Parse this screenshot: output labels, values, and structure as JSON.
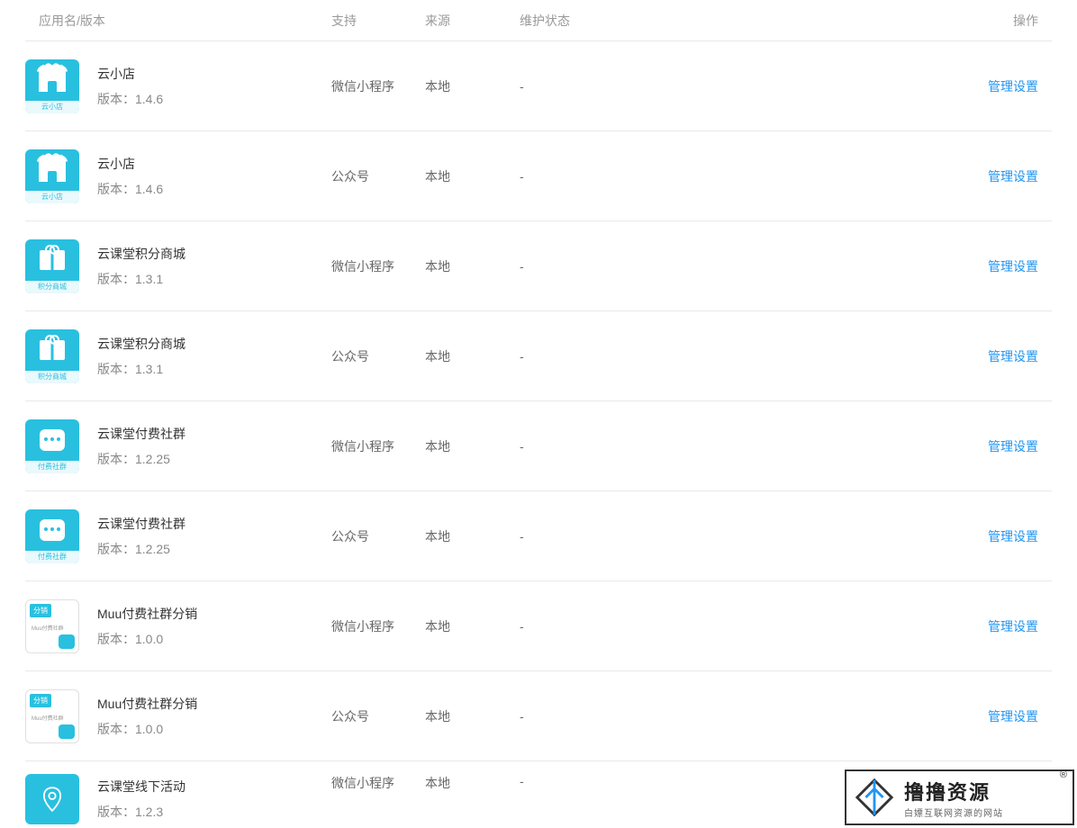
{
  "header": {
    "name": "应用名/版本",
    "support": "支持",
    "source": "来源",
    "status": "维护状态",
    "action": "操作"
  },
  "version_prefix": "版本：",
  "action_label": "管理设置",
  "rows": [
    {
      "name": "云小店",
      "version": "1.4.6",
      "support": "微信小程序",
      "source": "本地",
      "status": "-",
      "icon": "shop",
      "icon_label": "云小店"
    },
    {
      "name": "云小店",
      "version": "1.4.6",
      "support": "公众号",
      "source": "本地",
      "status": "-",
      "icon": "shop",
      "icon_label": "云小店"
    },
    {
      "name": "云课堂积分商城",
      "version": "1.3.1",
      "support": "微信小程序",
      "source": "本地",
      "status": "-",
      "icon": "gift",
      "icon_label": "积分商城"
    },
    {
      "name": "云课堂积分商城",
      "version": "1.3.1",
      "support": "公众号",
      "source": "本地",
      "status": "-",
      "icon": "gift",
      "icon_label": "积分商城"
    },
    {
      "name": "云课堂付费社群",
      "version": "1.2.25",
      "support": "微信小程序",
      "source": "本地",
      "status": "-",
      "icon": "chat",
      "icon_label": "付费社群"
    },
    {
      "name": "云课堂付费社群",
      "version": "1.2.25",
      "support": "公众号",
      "source": "本地",
      "status": "-",
      "icon": "chat",
      "icon_label": "付费社群"
    },
    {
      "name": "Muu付费社群分销",
      "version": "1.0.0",
      "support": "微信小程序",
      "source": "本地",
      "status": "-",
      "icon": "dist",
      "icon_label": ""
    },
    {
      "name": "Muu付费社群分销",
      "version": "1.0.0",
      "support": "公众号",
      "source": "本地",
      "status": "-",
      "icon": "dist",
      "icon_label": ""
    },
    {
      "name": "云课堂线下活动",
      "version": "1.2.3",
      "support": "微信小程序",
      "source": "本地",
      "status": "-",
      "icon": "pin",
      "icon_label": ""
    }
  ],
  "watermark": {
    "title": "撸撸资源",
    "subtitle": "白嫖互联网资源的网站",
    "r": "®"
  },
  "dist_badge": "分销",
  "dist_text": "Muu付费社群"
}
